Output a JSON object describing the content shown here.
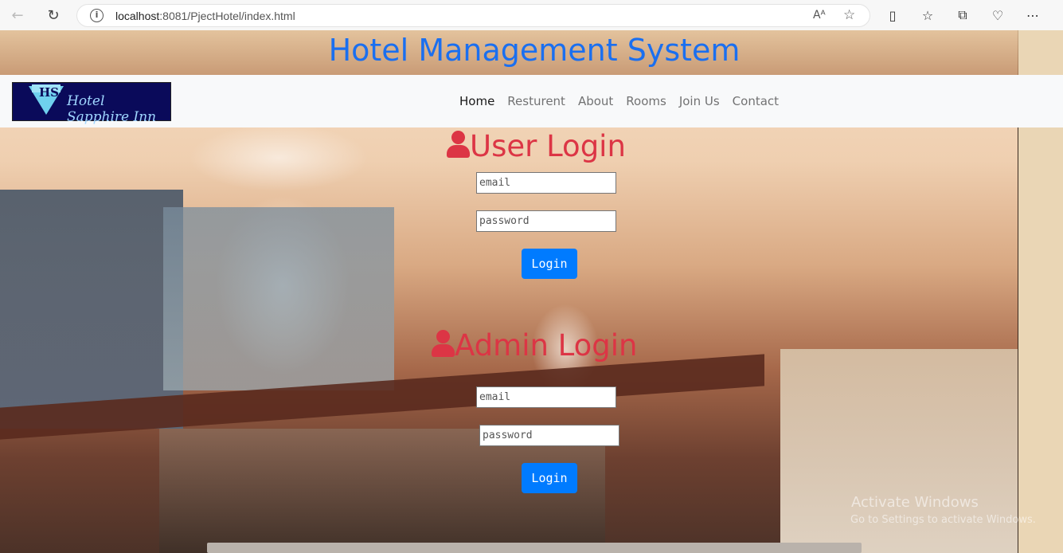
{
  "browser": {
    "url_host": "localhost",
    "url_path": ":8081/PjectHotel/index.html",
    "reader_label": "Aᴬ"
  },
  "page": {
    "title": "Hotel Management System",
    "logo_monogram": "HS",
    "logo_text": "Hotel Sapphire Inn",
    "nav": [
      "Home",
      "Resturent",
      "About",
      "Rooms",
      "Join Us",
      "Contact"
    ],
    "active_nav": "Home"
  },
  "user_login": {
    "title": "User Login",
    "email_placeholder": "email",
    "password_placeholder": "password",
    "button": "Login"
  },
  "admin_login": {
    "title": "Admin Login",
    "email_placeholder": "email",
    "password_placeholder": "password",
    "button": "Login"
  },
  "watermark": {
    "line1": "Activate Windows",
    "line2": "Go to Settings to activate Windows."
  },
  "colors": {
    "title_blue": "#1a6ff0",
    "login_red": "#dc3545",
    "button_blue": "#007bff"
  }
}
